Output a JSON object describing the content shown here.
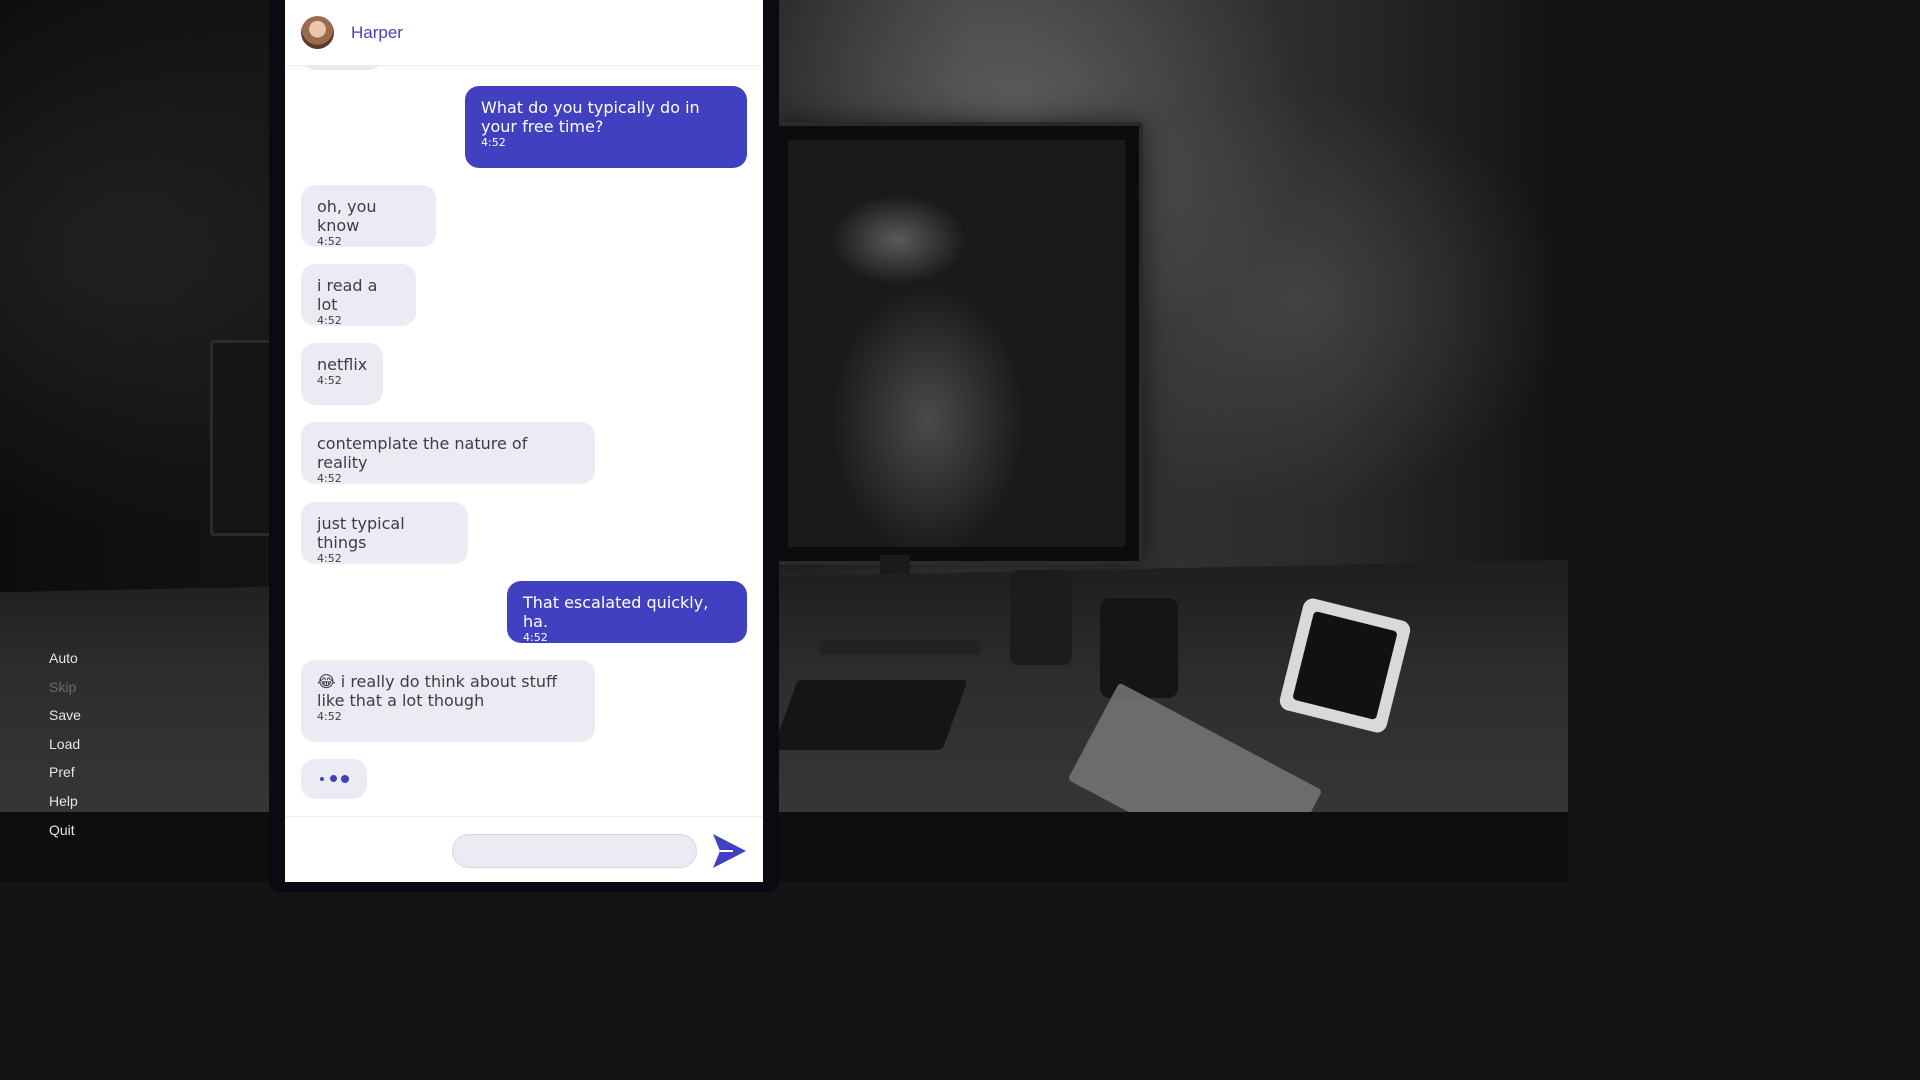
{
  "chat": {
    "contact_name": "Harper",
    "messages": [
      {
        "direction": "out",
        "text": "What do you typically do in your free time?",
        "time": "4:52"
      },
      {
        "direction": "in",
        "text": "oh, you know",
        "time": "4:52"
      },
      {
        "direction": "in",
        "text": "i read a lot",
        "time": "4:52"
      },
      {
        "direction": "in",
        "text": "netflix",
        "time": "4:52"
      },
      {
        "direction": "in",
        "text": "contemplate the nature of reality",
        "time": "4:52"
      },
      {
        "direction": "in",
        "text": "just typical things",
        "time": "4:52"
      },
      {
        "direction": "out",
        "text": "That escalated quickly, ha.",
        "time": "4:52"
      },
      {
        "direction": "in",
        "emoji": "😂",
        "text": "i really do think about stuff like that a lot though",
        "time": "4:52"
      }
    ],
    "typing_indicator": "•••",
    "composer": {
      "placeholder": "",
      "send_icon": "send-icon"
    }
  },
  "menu": {
    "items": [
      {
        "label": "Auto",
        "enabled": true
      },
      {
        "label": "Skip",
        "enabled": false
      },
      {
        "label": "Save",
        "enabled": true
      },
      {
        "label": "Load",
        "enabled": true
      },
      {
        "label": "Pref",
        "enabled": true
      },
      {
        "label": "Help",
        "enabled": true
      },
      {
        "label": "Quit",
        "enabled": true
      }
    ]
  },
  "colors": {
    "accent": "#4140c0",
    "incoming_bubble": "#ebebf3",
    "incoming_text": "#3d3d4a",
    "outgoing_text": "#ffffff"
  }
}
